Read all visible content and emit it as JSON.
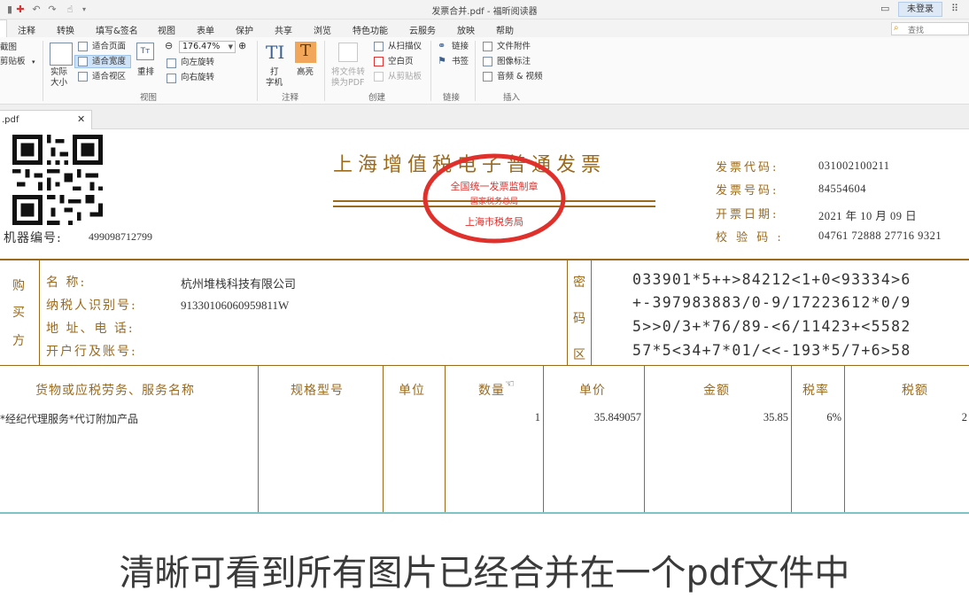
{
  "window": {
    "title": "发票合并.pdf - 福昕阅读器",
    "account_label": "未登录"
  },
  "menu": {
    "tabs": [
      "注释",
      "转换",
      "填写&签名",
      "视图",
      "表单",
      "保护",
      "共享",
      "浏览",
      "特色功能",
      "云服务",
      "放映",
      "帮助"
    ],
    "search_placeholder": "查找"
  },
  "ribbon": {
    "screenshot": "截图",
    "clipboard": "剪贴板",
    "actual_size_1": "实际",
    "actual_size_2": "大小",
    "fit_page": "适合页面",
    "fit_width": "适合宽度",
    "fit_visible": "适合视区",
    "reflow": "重排",
    "zoom_value": "176.47%",
    "rotate_left": "向左旋转",
    "rotate_right": "向右旋转",
    "group_view": "视图",
    "typewriter_1": "打",
    "typewriter_2": "字机",
    "highlight": "高亮",
    "group_comment": "注释",
    "convert_pdf_1": "将文件转",
    "convert_pdf_2": "换为PDF",
    "from_scanner": "从扫描仪",
    "blank_page": "空白页",
    "from_clipboard": "从剪贴板",
    "group_create": "创建",
    "link": "链接",
    "bookmark": "书签",
    "group_link": "链接",
    "file_attachment": "文件附件",
    "image_annotation": "图像标注",
    "audio_video": "音频 & 视频",
    "group_insert": "插入"
  },
  "doc_tab": {
    "label": ".pdf"
  },
  "invoice": {
    "title": "上海增值税电子普通发票",
    "seal_top": "全国统一发票监制章",
    "seal_mid": "国家税务总局",
    "seal_bottom": "上海市税务局",
    "machine_no_label": "机器编号:",
    "machine_no": "499098712799",
    "code_label": "发票代码:",
    "code": "031002100211",
    "number_label": "发票号码:",
    "number": "84554604",
    "date_label": "开票日期:",
    "date": "2021 年 10 月 09 日",
    "check_label": "校 验 码 :",
    "check": "04761 72888 27716 9321",
    "buyer_side": [
      "购",
      "买",
      "方"
    ],
    "buyer_name_label": "名          称:",
    "buyer_name": "杭州堆栈科技有限公司",
    "buyer_taxid_label": "纳税人识别号:",
    "buyer_taxid": "91330106060959811W",
    "buyer_address_label": "地  址、电  话:",
    "buyer_bank_label": "开户行及账号:",
    "cipher_side": [
      "密",
      "码",
      "区"
    ],
    "cipher_lines": [
      "033901*5++>84212<1+0<93334>6",
      "+-397983883/0-9/17223612*0/9",
      "5>>0/3+*76/89-<6/11423+<5582",
      "57*5<34+7*01/<<-193*5/7+6>58"
    ],
    "columns": {
      "item": "货物或应税劳务、服务名称",
      "spec": "规格型号",
      "unit": "单位",
      "qty": "数量",
      "price": "单价",
      "amount": "金额",
      "rate": "税率",
      "tax": "税额"
    },
    "row": {
      "item": "*经纪代理服务*代订附加产品",
      "qty": "1",
      "price": "35.849057",
      "amount": "35.85",
      "rate": "6%",
      "tax": "2"
    }
  },
  "subtitle": "清晰可看到所有图片已经合并在一个pdf文件中",
  "colors": {
    "invoice_brown": "#9b6a1c",
    "seal_red": "#e0302c",
    "highlight_orange": "#f2a65a"
  }
}
